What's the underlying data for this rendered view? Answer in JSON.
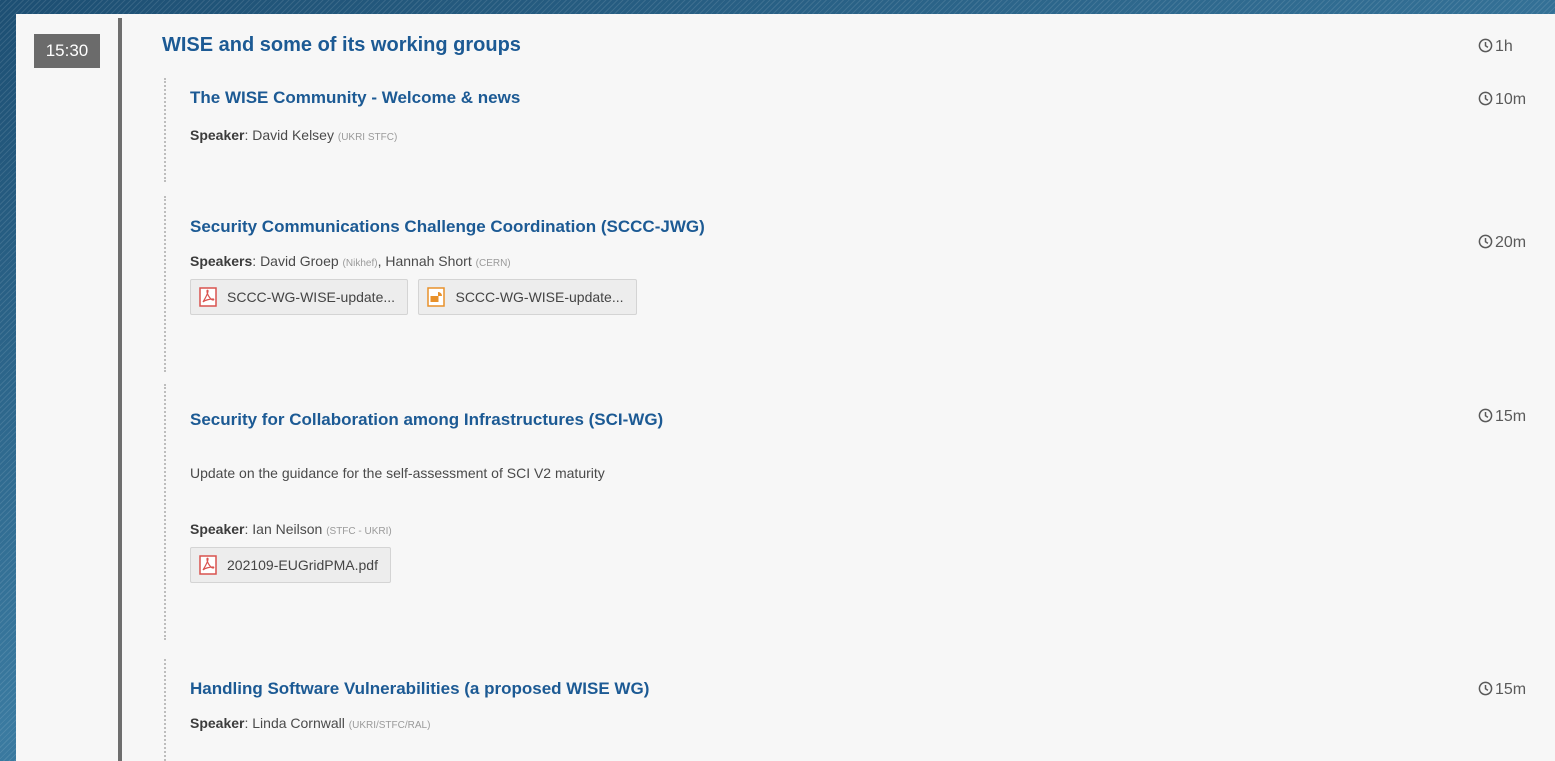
{
  "block": {
    "time": "15:30",
    "title": "WISE and some of its working groups",
    "duration": "1h"
  },
  "contributions": [
    {
      "title": "The WISE Community - Welcome & news",
      "duration": "10m",
      "speaker_label": "Speaker",
      "speakers": [
        {
          "name": "David Kelsey",
          "affiliation": "(UKRI STFC)"
        }
      ]
    },
    {
      "title": "Security Communications Challenge Coordination (SCCC-JWG)",
      "duration": "20m",
      "speaker_label": "Speakers",
      "speakers": [
        {
          "name": "David Groep",
          "affiliation": "(Nikhef)"
        },
        {
          "name": "Hannah Short",
          "affiliation": "(CERN)"
        }
      ],
      "attachments": [
        {
          "label": "SCCC-WG-WISE-update...",
          "icon": "pdf-icon"
        },
        {
          "label": "SCCC-WG-WISE-update...",
          "icon": "presentation-icon"
        }
      ]
    },
    {
      "title": "Security for Collaboration among Infrastructures (SCI-WG)",
      "duration": "15m",
      "description": "Update on the guidance for the self-assessment of SCI V2 maturity",
      "speaker_label": "Speaker",
      "speakers": [
        {
          "name": "Ian Neilson",
          "affiliation": "(STFC - UKRI)"
        }
      ],
      "attachments": [
        {
          "label": "202109-EUGridPMA.pdf",
          "icon": "pdf-icon"
        }
      ]
    },
    {
      "title": "Handling Software Vulnerabilities (a proposed WISE WG)",
      "duration": "15m",
      "speaker_label": "Speaker",
      "speakers": [
        {
          "name": "Linda Cornwall",
          "affiliation": "(UKRI/STFC/RAL)"
        }
      ]
    }
  ],
  "colors": {
    "title_blue": "#1c5a94",
    "time_badge": "#6b6b6b",
    "pdf_red": "#d9534f",
    "ppt_orange": "#e8912b"
  }
}
